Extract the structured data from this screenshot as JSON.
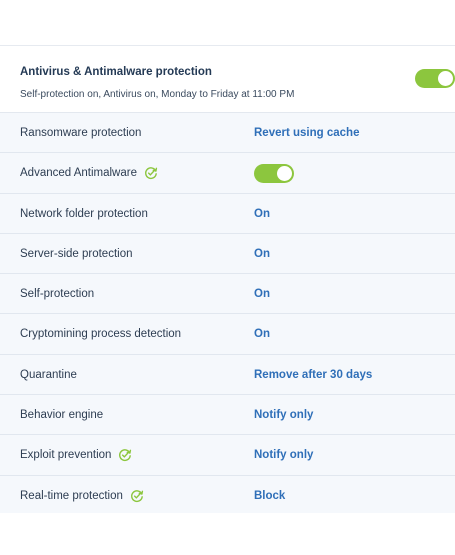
{
  "header": {
    "title": "Antivirus & Antimalware protection",
    "subtitle": "Self-protection on, Antivirus on, Monday to Friday at 11:00 PM",
    "toggle_on": true
  },
  "colors": {
    "toggle_on": "#8cc63e",
    "value_link": "#2f6fb8",
    "check_icon": "#8cc63e"
  },
  "rows": [
    {
      "label": "Ransomware protection",
      "value": "Revert using cache"
    },
    {
      "label": "Advanced Antimalware",
      "value": "",
      "toggle_on": true,
      "icon": "refresh-check-icon"
    },
    {
      "label": "Network folder protection",
      "value": "On"
    },
    {
      "label": "Server-side protection",
      "value": "On"
    },
    {
      "label": "Self-protection",
      "value": "On"
    },
    {
      "label": "Cryptomining process detection",
      "value": "On"
    },
    {
      "label": "Quarantine",
      "value": "Remove after 30 days"
    },
    {
      "label": "Behavior engine",
      "value": "Notify only"
    },
    {
      "label": "Exploit prevention",
      "value": "Notify only",
      "icon": "refresh-check-icon"
    },
    {
      "label": "Real-time protection",
      "value": "Block",
      "icon": "refresh-check-icon"
    }
  ]
}
